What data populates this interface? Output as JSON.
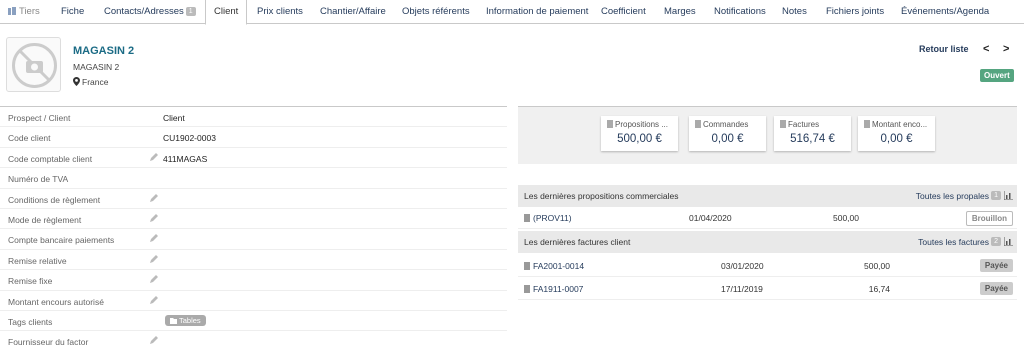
{
  "tabs": {
    "tiers": "Tiers",
    "fiche": "Fiche",
    "contacts": "Contacts/Adresses",
    "contacts_count": "1",
    "client": "Client",
    "prix": "Prix clients",
    "chantier": "Chantier/Affaire",
    "objets": "Objets référents",
    "paiement": "Information de paiement",
    "coefficient": "Coefficient",
    "marges": "Marges",
    "notifications": "Notifications",
    "notes": "Notes",
    "fichiers": "Fichiers joints",
    "evenements": "Événements/Agenda"
  },
  "header": {
    "name": "MAGASIN 2",
    "subname": "MAGASIN 2",
    "country": "France",
    "retour": "Retour liste",
    "prev": "<",
    "next": ">",
    "status": "Ouvert"
  },
  "fields": [
    {
      "label": "Prospect / Client",
      "value": "Client"
    },
    {
      "label": "Code client",
      "value": "CU1902-0003"
    },
    {
      "label": "Code comptable client",
      "value": "411MAGAS"
    },
    {
      "label": "Numéro de TVA",
      "value": ""
    },
    {
      "label": "Conditions de règlement",
      "value": ""
    },
    {
      "label": "Mode de règlement",
      "value": ""
    },
    {
      "label": "Compte bancaire paiements",
      "value": ""
    },
    {
      "label": "Remise relative",
      "value": ""
    },
    {
      "label": "Remise fixe",
      "value": ""
    },
    {
      "label": "Montant encours autorisé",
      "value": ""
    },
    {
      "label": "Tags clients",
      "value": "Tables"
    },
    {
      "label": "Fournisseur du factor",
      "value": ""
    }
  ],
  "stats": [
    {
      "label": "Propositions ...",
      "value": "500,00 €"
    },
    {
      "label": "Commandes",
      "value": "0,00 €"
    },
    {
      "label": "Factures",
      "value": "516,74 €"
    },
    {
      "label": "Montant enco...",
      "value": "0,00 €"
    }
  ],
  "propales": {
    "title": "Les dernières propositions commerciales",
    "link": "Toutes les propales",
    "count": "1",
    "rows": [
      {
        "ref": "(PROV11)",
        "date": "01/04/2020",
        "amount": "500,00",
        "status": "Brouillon"
      }
    ]
  },
  "factures": {
    "title": "Les dernières factures client",
    "link": "Toutes les factures",
    "count": "2",
    "rows": [
      {
        "ref": "FA2001-0014",
        "date": "03/01/2020",
        "amount": "500,00",
        "status": "Payée"
      },
      {
        "ref": "FA1911-0007",
        "date": "17/11/2019",
        "amount": "16,74",
        "status": "Payée"
      }
    ]
  },
  "colors": {
    "accent": "#263c5c",
    "name": "#1b6b85",
    "ouvert": "#55a580"
  }
}
